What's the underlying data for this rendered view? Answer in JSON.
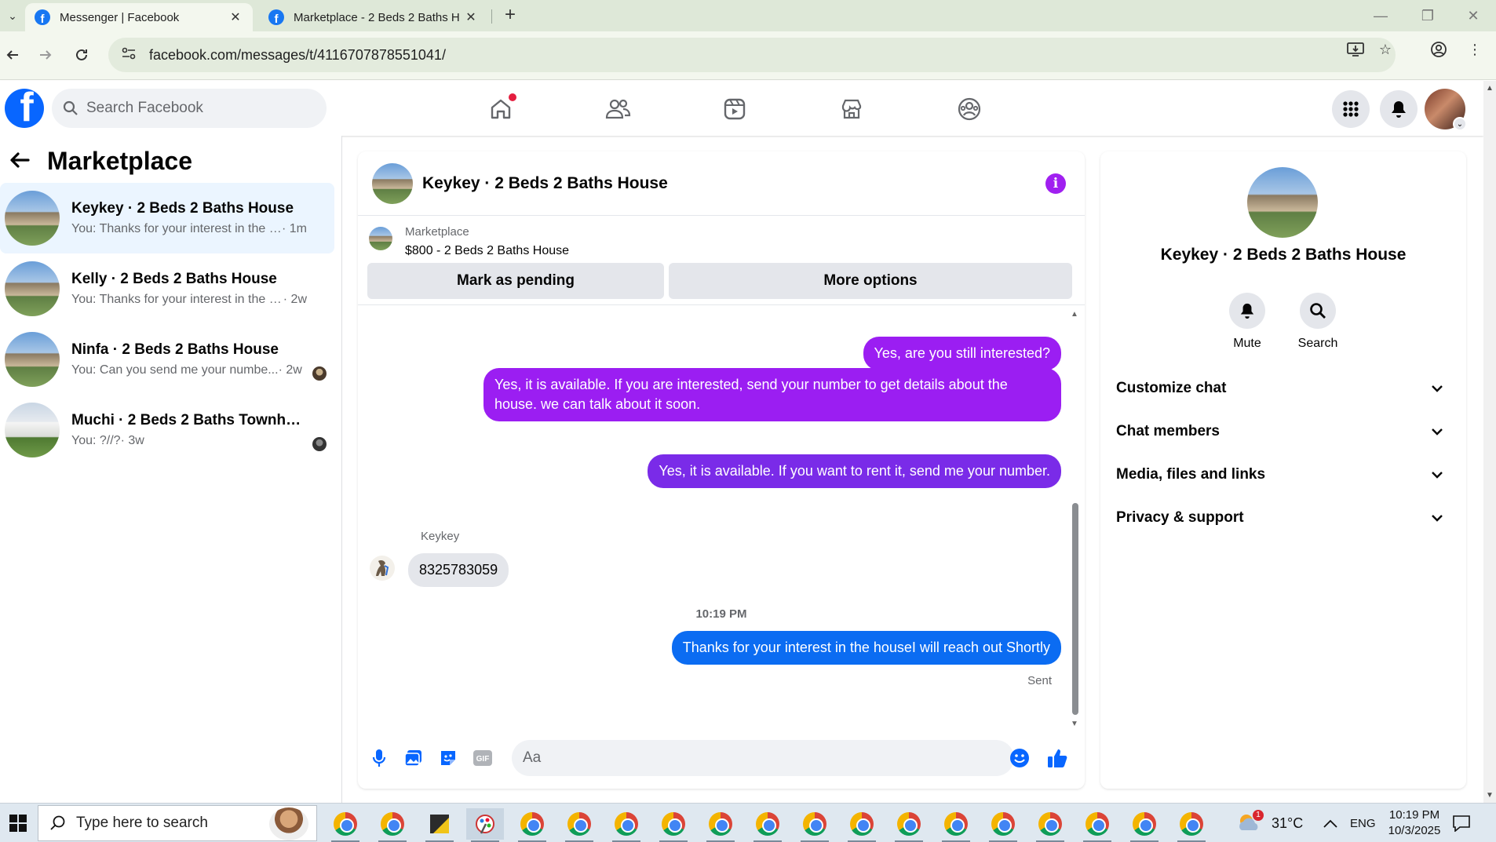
{
  "browser": {
    "tabs": [
      {
        "title": "Messenger | Facebook",
        "active": true
      },
      {
        "title": "Marketplace - 2 Beds 2 Baths H",
        "active": false
      }
    ],
    "url": "facebook.com/messages/t/4116707878551041/"
  },
  "header": {
    "search_placeholder": "Search Facebook",
    "home_notification": true
  },
  "sidebar": {
    "title": "Marketplace",
    "conversations": [
      {
        "name": "Keykey · 2 Beds 2 Baths House",
        "preview": "You: Thanks for your interest in the h...",
        "time": "· 1m",
        "active": true,
        "seen_avatar": false
      },
      {
        "name": "Kelly · 2 Beds 2 Baths House",
        "preview": "You: Thanks for your interest in the h...",
        "time": "· 2w",
        "active": false,
        "seen_avatar": false
      },
      {
        "name": "Ninfa · 2 Beds 2 Baths House",
        "preview": "You: Can you send me your numbe...",
        "time": "· 2w",
        "active": false,
        "seen_avatar": true
      },
      {
        "name": "Muchi · 2 Beds 2 Baths Townhou...",
        "preview": "You: ?//?",
        "time": "· 3w",
        "active": false,
        "seen_avatar": true
      }
    ]
  },
  "chat": {
    "title": "Keykey · 2 Beds 2 Baths House",
    "listing": {
      "label": "Marketplace",
      "price_title": "$800 - 2 Beds 2 Baths House",
      "mark_pending": "Mark as pending",
      "more_options": "More options"
    },
    "messages": [
      {
        "from": "me",
        "text": "Yes, are you still interested?"
      },
      {
        "from": "me",
        "text": "Yes, it is available. If you are interested, send your number to get details about the house. we can talk about it soon."
      },
      {
        "from": "me",
        "text": "Yes, it is available. If you want to rent it, send me your number."
      },
      {
        "from": "them",
        "sender": "Keykey",
        "text": "8325783059"
      },
      {
        "timestamp": "10:19 PM"
      },
      {
        "from": "me",
        "text": "Thanks for your interest in the houseI will reach out Shortly"
      }
    ],
    "status": "Sent",
    "composer_placeholder": "Aa"
  },
  "info_panel": {
    "name": "Keykey · 2 Beds 2 Baths House",
    "actions": [
      "Mute",
      "Search"
    ],
    "sections": [
      "Customize chat",
      "Chat members",
      "Media, files and links",
      "Privacy & support"
    ]
  },
  "taskbar": {
    "search_placeholder": "Type here to search",
    "temperature": "31°C",
    "language": "ENG",
    "time": "10:19 PM",
    "date": "10/3/2025",
    "weather_badge": "1"
  },
  "colors": {
    "fb_blue": "#0866ff",
    "bubble_purple": "#9b1ef2",
    "bubble_violet": "#7a2be8",
    "bubble_blue": "#0b6cf2",
    "active_row": "#ebf5ff"
  }
}
